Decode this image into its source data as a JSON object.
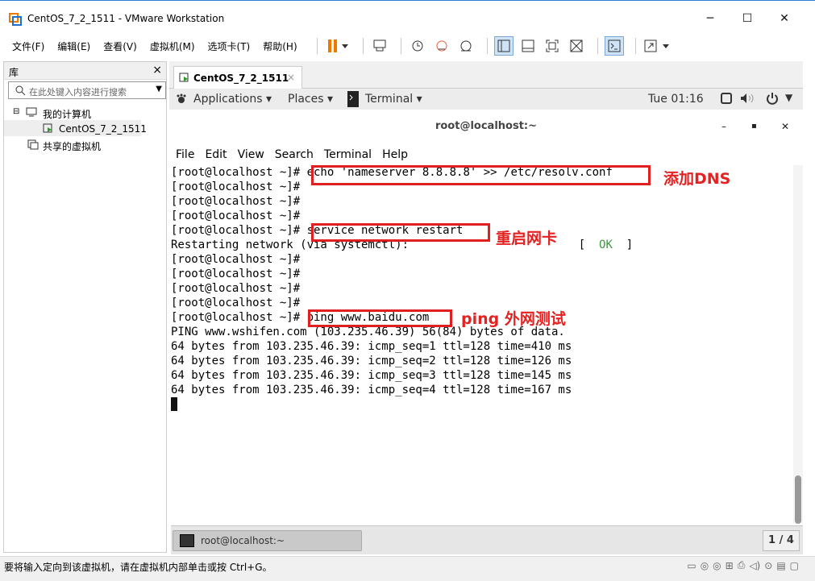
{
  "window": {
    "title": "CentOS_7_2_1511 - VMware Workstation",
    "minimize": "─",
    "maximize": "☐",
    "close": "✕"
  },
  "menu": {
    "items": [
      "文件(F)",
      "编辑(E)",
      "查看(V)",
      "虚拟机(M)",
      "选项卡(T)",
      "帮助(H)"
    ]
  },
  "library": {
    "title": "库",
    "close": "×",
    "search_placeholder": "在此处键入内容进行搜索",
    "tree": {
      "my_computer": "我的计算机",
      "vm": "CentOS_7_2_1511",
      "shared": "共享的虚拟机"
    }
  },
  "vm_tab": {
    "label": "CentOS_7_2_1511",
    "close": "×"
  },
  "gnome": {
    "applications": "Applications ▾",
    "places": "Places ▾",
    "terminal": "Terminal ▾",
    "time": "Tue 01:16"
  },
  "terminal_window": {
    "title": "root@localhost:~",
    "min": "–",
    "max": "▪",
    "close": "✕",
    "menu": [
      "File",
      "Edit",
      "View",
      "Search",
      "Terminal",
      "Help"
    ]
  },
  "terminal": {
    "prompt": "[root@localhost ~]# ",
    "cmd_echo": "echo 'nameserver 8.8.8.8' >> /etc/resolv.conf",
    "cmd_restart": "service network restart",
    "restart_output": "Restarting network (via systemctl):                         [  ",
    "ok": "OK",
    "ok_close": "  ]",
    "cmd_ping": "ping www.baidu.com",
    "ping_header": "PING www.wshifen.com (103.235.46.39) 56(84) bytes of data.",
    "ping_lines": [
      "64 bytes from 103.235.46.39: icmp_seq=1 ttl=128 time=410 ms",
      "64 bytes from 103.235.46.39: icmp_seq=2 ttl=128 time=126 ms",
      "64 bytes from 103.235.46.39: icmp_seq=3 ttl=128 time=145 ms",
      "64 bytes from 103.235.46.39: icmp_seq=4 ttl=128 time=167 ms"
    ]
  },
  "annotations": {
    "dns": "添加DNS",
    "restart": "重启网卡",
    "ping": "ping 外网测试"
  },
  "taskbar": {
    "item": "root@localhost:~",
    "pager": "1 / 4"
  },
  "status": {
    "message": "要将输入定向到该虚拟机，请在虚拟机内部单击或按 Ctrl+G。"
  },
  "colors": {
    "accent_red": "#e02020",
    "pause_orange": "#f07800",
    "ok_green": "#3a9a3a"
  }
}
